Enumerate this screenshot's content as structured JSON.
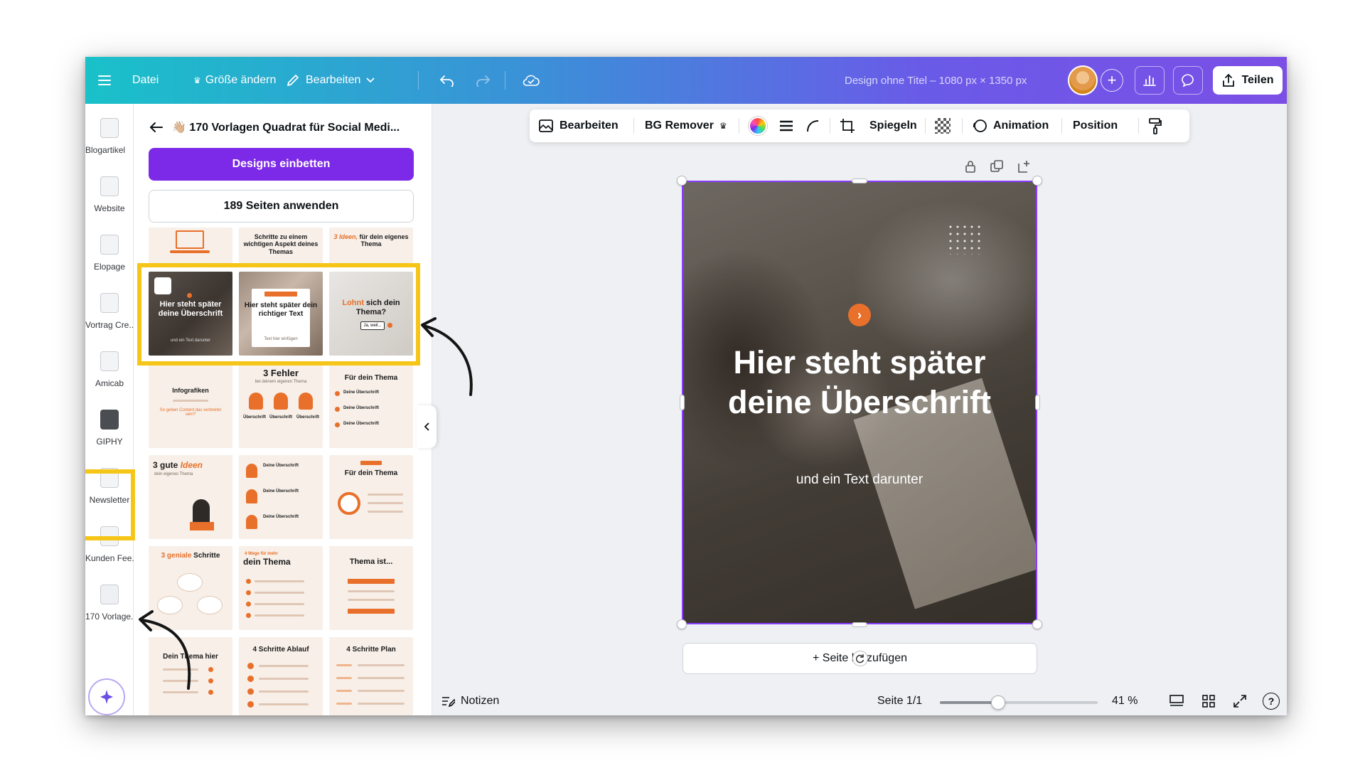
{
  "topbar": {
    "menu_icon": "hamburger-icon",
    "file_label": "Datei",
    "resize_label": "Größe ändern",
    "edit_label": "Bearbeiten",
    "doc_title": "Design ohne Titel – 1080 px × 1350 px",
    "share_label": "Teilen"
  },
  "rail": {
    "items": [
      {
        "label": "Blogartikel"
      },
      {
        "label": "Website"
      },
      {
        "label": "Elopage"
      },
      {
        "label": "Vortrag Cre..."
      },
      {
        "label": "Amicab"
      },
      {
        "label": "GIPHY"
      },
      {
        "label": "Newsletter"
      },
      {
        "label": "Kunden Fee..."
      },
      {
        "label": "170 Vorlage..."
      }
    ]
  },
  "panel": {
    "title": "👋🏼 170 Vorlagen Quadrat für Social Medi...",
    "embed_button": "Designs einbetten",
    "apply_button": "189 Seiten anwenden",
    "thumbs": {
      "r0c1": "Schritte zu einem wichtigen Aspekt deines Themas",
      "r0c2_hl": "3 Ideen,",
      "r0c2": " für dein eigenes Thema",
      "r1c0": "Hier steht später deine Überschrift",
      "r1c0_sub": "und ein Text darunter",
      "r1c1": "Hier steht später dein richtiger Text",
      "r1c1_sub": "Text hier einfügen",
      "r1c2_hl": "Lohnt",
      "r1c2": " sich dein Thema?",
      "r1c2_btn": "Ja, weil...",
      "r2c0": "Infografiken",
      "r2c0_sub": "So geben Content das verbreitet sein?",
      "r2c1": "3 Fehler",
      "r2c1_sub": "bei deinem eigenen Thema",
      "r2c1_col": "Überschrift",
      "r2c2": "Für dein Thema",
      "r2c2_item": "Deine Überschrift",
      "r3c0_a": "3 gute ",
      "r3c0_hl": "Ideen",
      "r3c0_sub": "dein eigenes Thema",
      "r3c1_item": "Deine Überschrift",
      "r3c2": "Für dein Thema",
      "r4c0_hl": "3 geniale",
      "r4c0": " Schritte",
      "r4c1_small": "4 Wege für mehr",
      "r4c1": "dein Thema",
      "r4c2": "Thema ist...",
      "r5c0": "Dein Thema hier",
      "r5c1": "4 Schritte Ablauf",
      "r5c2": "4 Schritte Plan"
    }
  },
  "context_toolbar": {
    "edit": "Bearbeiten",
    "bg_remover": "BG Remover",
    "flip": "Spiegeln",
    "animation": "Animation",
    "position": "Position"
  },
  "design": {
    "headline": "Hier steht später deine Überschrift",
    "subline": "und ein Text darunter"
  },
  "add_page": "+ Seite hinzufügen",
  "bottombar": {
    "notes": "Notizen",
    "page_indicator": "Seite 1/1",
    "zoom": "41 %"
  },
  "colors": {
    "accent": "#7d2ae8",
    "brand_orange": "#e8702a",
    "highlight_yellow": "#f5c518",
    "selection": "#8b3dff"
  },
  "zoom_fraction": 0.41
}
